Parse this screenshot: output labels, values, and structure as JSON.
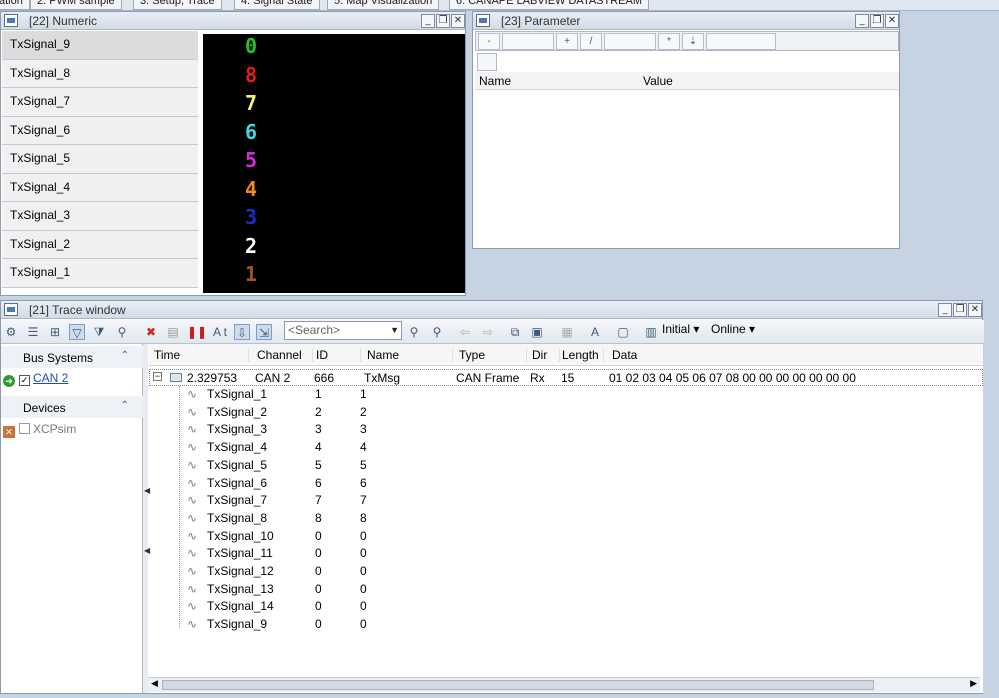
{
  "tabstrip": {
    "tabs": [
      {
        "label": "ation"
      },
      {
        "label": "2. PWM sample"
      },
      {
        "label": "3. Setup, Trace"
      },
      {
        "label": "4. Signal State"
      },
      {
        "label": "5. Map Visualization"
      },
      {
        "label": "6. CANAPE LABVIEW DATASTREAM"
      }
    ]
  },
  "numeric_window": {
    "title": "[22] Numeric",
    "signals": [
      {
        "name": "TxSignal_9",
        "value": "0",
        "color": "#22c422"
      },
      {
        "name": "TxSignal_8",
        "value": "8",
        "color": "#e21f1f"
      },
      {
        "name": "TxSignal_7",
        "value": "7",
        "color": "#f4f466"
      },
      {
        "name": "TxSignal_6",
        "value": "6",
        "color": "#3fd9e3"
      },
      {
        "name": "TxSignal_5",
        "value": "5",
        "color": "#d62ad6"
      },
      {
        "name": "TxSignal_4",
        "value": "4",
        "color": "#f08a1c"
      },
      {
        "name": "TxSignal_3",
        "value": "3",
        "color": "#1a2fc6"
      },
      {
        "name": "TxSignal_2",
        "value": "2",
        "color": "#ffffff"
      },
      {
        "name": "TxSignal_1",
        "value": "1",
        "color": "#a4531b"
      }
    ]
  },
  "parameter_window": {
    "title": "[23] Parameter",
    "columns": {
      "name": "Name",
      "value": "Value"
    }
  },
  "trace_window": {
    "title": "[21] Trace window",
    "search_placeholder": "<Search>",
    "initial_label": "Initial",
    "online_label": "Online",
    "bus_systems_label": "Bus Systems",
    "can_channel": "CAN 2",
    "devices_label": "Devices",
    "device": "XCPsim",
    "columns": {
      "time": "Time",
      "channel": "Channel",
      "id": "ID",
      "name": "Name",
      "type": "Type",
      "dir": "Dir",
      "length": "Length",
      "data": "Data"
    },
    "frame": {
      "time": "2.329753",
      "channel": "CAN 2",
      "id": "666",
      "name": "TxMsg",
      "type": "CAN Frame",
      "dir": "Rx",
      "length": "15",
      "data": "01  02  03  04  05  06  07  08  00  00  00  00  00  00  00"
    },
    "signals": [
      {
        "name": "TxSignal_1",
        "raw": "1",
        "phys": "1"
      },
      {
        "name": "TxSignal_2",
        "raw": "2",
        "phys": "2"
      },
      {
        "name": "TxSignal_3",
        "raw": "3",
        "phys": "3"
      },
      {
        "name": "TxSignal_4",
        "raw": "4",
        "phys": "4"
      },
      {
        "name": "TxSignal_5",
        "raw": "5",
        "phys": "5"
      },
      {
        "name": "TxSignal_6",
        "raw": "6",
        "phys": "6"
      },
      {
        "name": "TxSignal_7",
        "raw": "7",
        "phys": "7"
      },
      {
        "name": "TxSignal_8",
        "raw": "8",
        "phys": "8"
      },
      {
        "name": "TxSignal_10",
        "raw": "0",
        "phys": "0"
      },
      {
        "name": "TxSignal_11",
        "raw": "0",
        "phys": "0"
      },
      {
        "name": "TxSignal_12",
        "raw": "0",
        "phys": "0"
      },
      {
        "name": "TxSignal_13",
        "raw": "0",
        "phys": "0"
      },
      {
        "name": "TxSignal_14",
        "raw": "0",
        "phys": "0"
      },
      {
        "name": "TxSignal_9",
        "raw": "0",
        "phys": "0"
      }
    ]
  }
}
